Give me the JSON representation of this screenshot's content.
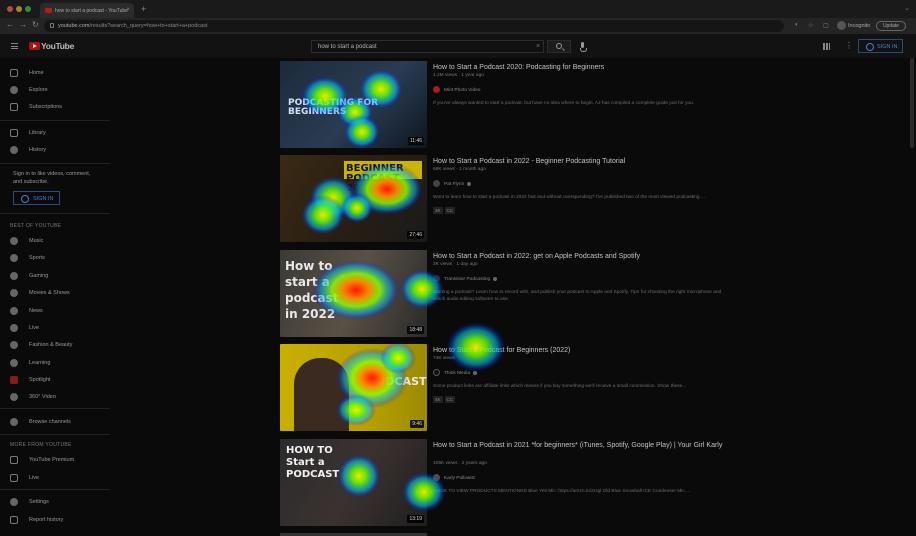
{
  "browser": {
    "tab_title": "how to start a podcast - YouTube",
    "new_tab": "+",
    "tab_close": "×",
    "chevron": "⌄",
    "url_host": "youtube.com",
    "url_path": "/results?search_query=how+to+start+a+podcast",
    "back": "←",
    "forward": "→",
    "reload": "↻",
    "incognito_label": "Incognito",
    "update_label": "Update",
    "traffic_colors": [
      "#ff5f57",
      "#febc2e",
      "#28c840"
    ]
  },
  "header": {
    "logo_text": "YouTube",
    "search_value": "how to start a podcast",
    "signin_label": "SIGN IN",
    "search_clear": "×",
    "more": "⋮"
  },
  "sidebar": {
    "items_top": [
      {
        "label": "Home",
        "icon": "home-icon"
      },
      {
        "label": "Explore",
        "icon": "compass-icon"
      },
      {
        "label": "Subscriptions",
        "icon": "subscriptions-icon"
      }
    ],
    "items_lib": [
      {
        "label": "Library",
        "icon": "library-icon"
      },
      {
        "label": "History",
        "icon": "history-icon"
      }
    ],
    "signin_prompt": "Sign in to like videos, comment, and subscribe.",
    "signin_label": "SIGN IN",
    "best_heading": "BEST OF YOUTUBE",
    "best_items": [
      {
        "label": "Music",
        "icon": "music-icon"
      },
      {
        "label": "Sports",
        "icon": "sports-icon"
      },
      {
        "label": "Gaming",
        "icon": "gaming-icon"
      },
      {
        "label": "Movies & Shows",
        "icon": "movies-icon"
      },
      {
        "label": "News",
        "icon": "news-icon"
      },
      {
        "label": "Live",
        "icon": "live-icon"
      },
      {
        "label": "Fashion & Beauty",
        "icon": "fashion-icon"
      },
      {
        "label": "Learning",
        "icon": "learning-icon"
      },
      {
        "label": "Spotlight",
        "icon": "spotlight-icon"
      },
      {
        "label": "360° Video",
        "icon": "360-video-icon"
      }
    ],
    "browse_channels": "Browse channels",
    "more_heading": "MORE FROM YOUTUBE",
    "more_items": [
      {
        "label": "YouTube Premium",
        "icon": "premium-icon"
      },
      {
        "label": "Live",
        "icon": "live-icon"
      }
    ],
    "settings_items": [
      {
        "label": "Settings",
        "icon": "settings-icon"
      },
      {
        "label": "Report history",
        "icon": "flag-icon"
      }
    ]
  },
  "results": [
    {
      "title": "How to Start a Podcast 2020: Podcasting for Beginners",
      "meta": "1.2M views · 1 year ago",
      "channel": "Mint Photo Video",
      "desc": "If you've always wanted to start a podcast, but have no idea where to begin, AJ has compiled a complete guide just for you.",
      "duration": "11:46",
      "thumb_text": "PODCASTING FOR BEGINNERS",
      "badges": []
    },
    {
      "title": "How to Start a Podcast in 2022 - Beginner Podcasting Tutorial",
      "meta": "68K views · 1 month ago",
      "channel": "Pat Flynn",
      "desc": "Want to learn how to start a podcast in 2022 fast and without overspending? I've published two of the most viewed podcasting ...",
      "duration": "27:46",
      "thumb_text": "BEGINNER PODCAST 2022",
      "badges": [
        "4K",
        "CC"
      ]
    },
    {
      "title": "How to Start a Podcast in 2022: get on Apple Podcasts and Spotify",
      "meta": "2K views · 1 day ago",
      "channel": "Transistor Podcasting",
      "desc": "Starting a podcast? Learn how to record with, and publish your podcast to Apple and Spotify. Tips for choosing the right microphone and which audio editing software to use.",
      "duration": "18:48",
      "thumb_text": "How to start a podcast in 2022",
      "badges": []
    },
    {
      "title": "How to Start a Podcast for Beginners (2022)",
      "meta": "74K views",
      "channel": "Think Media",
      "desc": "Some product links are affiliate links which means if you buy something we'll receive a small commission. Show these...",
      "duration": "9:46",
      "thumb_text": "PODCAST",
      "badges": [
        "4K",
        "CC"
      ]
    },
    {
      "title": "How to Start a Podcast in 2021 *for beginners* (iTunes, Spotify, Google Play) | Your Girl Karly",
      "meta": "105K views · 2 years ago",
      "channel": "Karly Pollowitz",
      "desc": "CLICK TO VIEW PRODUCTS MENTIONED Blue Yeti Mic: https://amzn.to/2IJgl Old Blue Snowball ICE Condenser Mic ...",
      "duration": "13:19",
      "thumb_text": "HOW TO Start a PODCAST",
      "badges": []
    }
  ],
  "colors": {
    "accent_blue": "#4f7fcf",
    "yt_red": "#a31515"
  }
}
